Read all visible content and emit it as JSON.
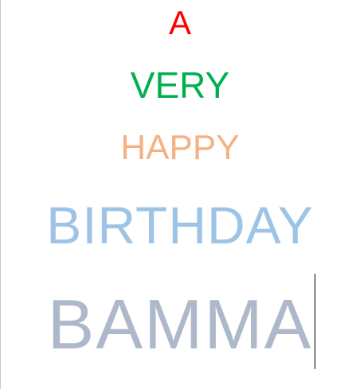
{
  "document": {
    "lines": [
      {
        "text": "A",
        "color": "#ff0000"
      },
      {
        "text": "VERY",
        "color": "#00b050"
      },
      {
        "text": "HAPPY",
        "color": "#f4b183"
      },
      {
        "text": "BIRTHDAY",
        "color": "#9dc3e6"
      },
      {
        "text": "BAMMA",
        "color": "#adb9ca"
      }
    ]
  }
}
